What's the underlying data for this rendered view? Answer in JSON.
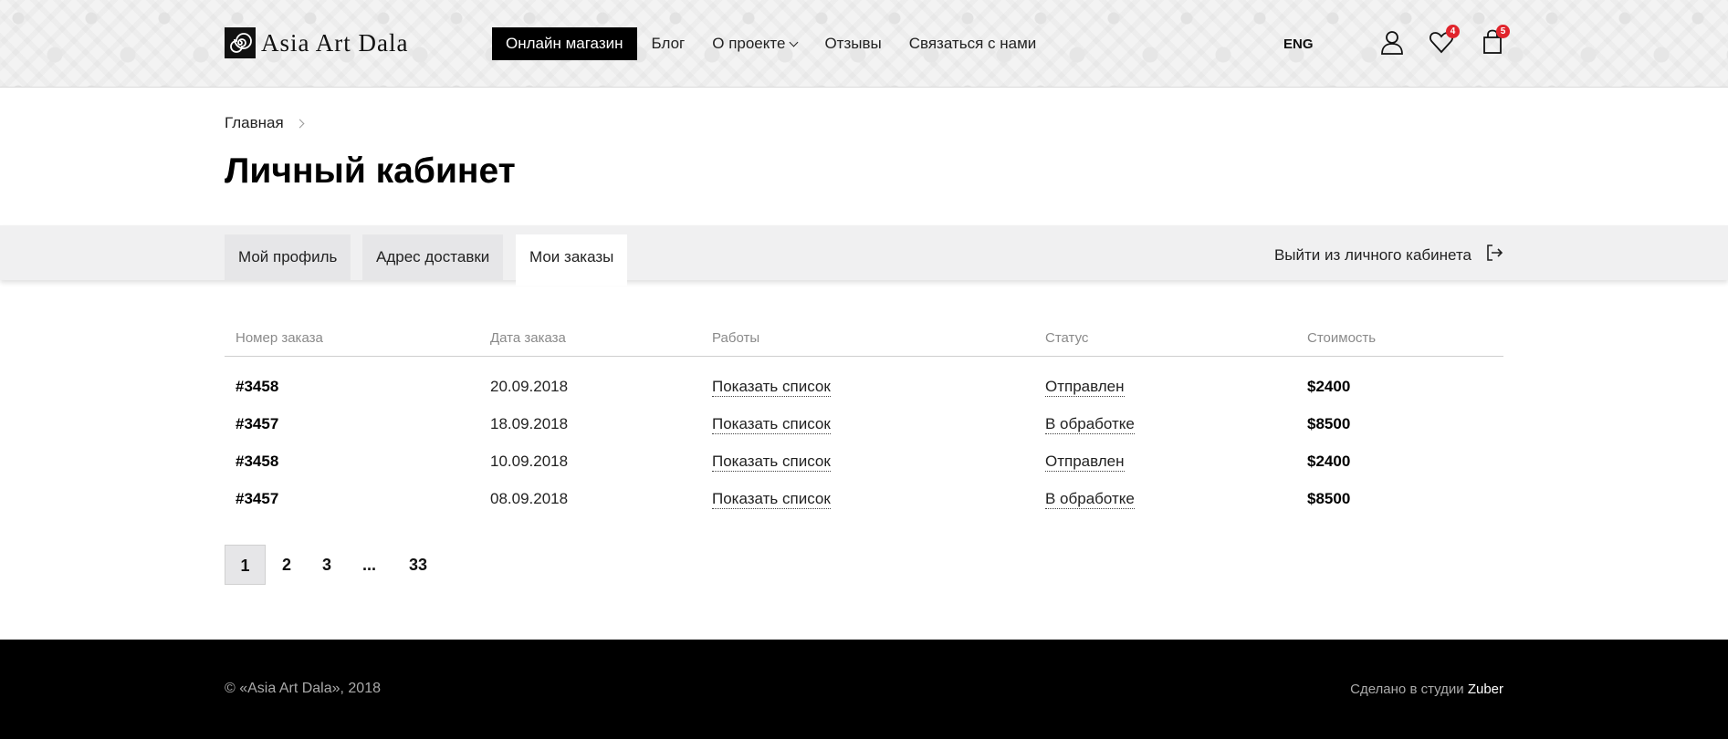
{
  "header": {
    "logo_text": "Asia Art Dala",
    "nav": [
      {
        "label": "Онлайн магазин"
      },
      {
        "label": "Блог"
      },
      {
        "label": "О проекте"
      },
      {
        "label": "Отзывы"
      },
      {
        "label": "Связаться с нами"
      }
    ],
    "lang": "ENG",
    "wishlist_count": "4",
    "cart_count": "5"
  },
  "breadcrumb": {
    "home": "Главная"
  },
  "page_title": "Личный кабинет",
  "tabs": [
    {
      "label": "Мой профиль"
    },
    {
      "label": "Адрес доставки"
    },
    {
      "label": "Мои заказы",
      "active": true
    }
  ],
  "logout_label": "Выйти из личного кабинета",
  "table": {
    "headers": [
      "Номер заказа",
      "Дата заказа",
      "Работы",
      "Статус",
      "Стоимость"
    ],
    "rows": [
      {
        "number": "#3458",
        "date": "20.09.2018",
        "works": "Показать список",
        "status": "Отправлен",
        "price": "$2400"
      },
      {
        "number": "#3457",
        "date": "18.09.2018",
        "works": "Показать список",
        "status": "В обработке",
        "price": "$8500"
      },
      {
        "number": "#3458",
        "date": "10.09.2018",
        "works": "Показать список",
        "status": "Отправлен",
        "price": "$2400"
      },
      {
        "number": "#3457",
        "date": "08.09.2018",
        "works": "Показать список",
        "status": "В обработке",
        "price": "$8500"
      }
    ]
  },
  "pagination": {
    "pages": [
      "1",
      "2",
      "3",
      "...",
      "33"
    ],
    "current": "1"
  },
  "footer": {
    "copyright": "© «Asia Art Dala», 2018",
    "studio_prefix": "Сделано в студии",
    "studio_name": "Zuber"
  },
  "colors": {
    "accent": "#000000",
    "badge": "#e0242c",
    "tab_bg": "#e6e6e8",
    "band_bg": "#f0f0f1"
  }
}
